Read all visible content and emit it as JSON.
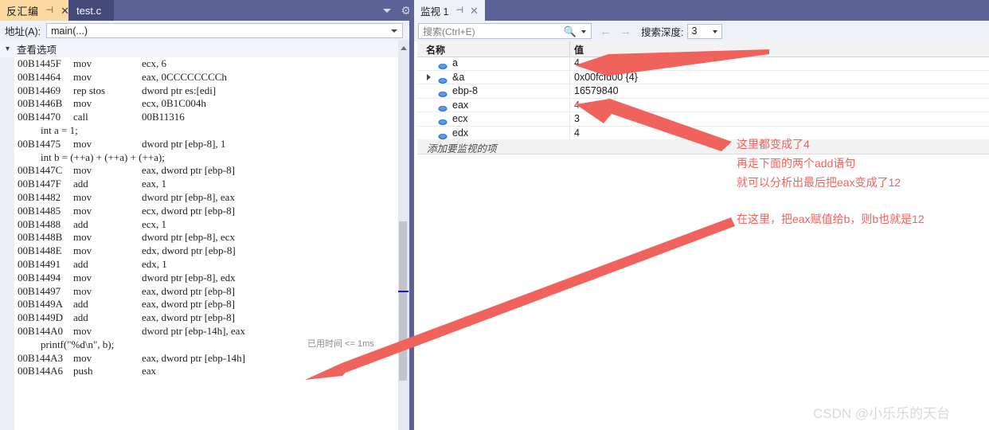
{
  "disassembly": {
    "tabs": [
      {
        "label": "反汇编",
        "active": true,
        "pin": "⊣",
        "close": "✕"
      },
      {
        "label": "test.c",
        "active": false
      }
    ],
    "address_bar": {
      "label": "地址(A):",
      "value": "main(...)"
    },
    "view_options": {
      "label": "查看选项",
      "chevron": "chevron-down-icon"
    },
    "elapsed_label": "已用时间 <= 1ms",
    "current_line_index": 27,
    "lines": [
      {
        "type": "asm",
        "addr": "00B1445F",
        "mn": "mov",
        "op": "ecx, 6"
      },
      {
        "type": "asm",
        "addr": "00B14464",
        "mn": "mov",
        "op": "eax, 0CCCCCCCCh"
      },
      {
        "type": "asm",
        "addr": "00B14469",
        "mn": "rep stos",
        "op": "dword ptr es:[edi]"
      },
      {
        "type": "asm",
        "addr": "00B1446B",
        "mn": "mov",
        "op": "ecx, 0B1C004h"
      },
      {
        "type": "asm",
        "addr": "00B14470",
        "mn": "call",
        "op": "00B11316"
      },
      {
        "type": "src",
        "text": "int a = 1;"
      },
      {
        "type": "asm",
        "addr": "00B14475",
        "mn": "mov",
        "op": "dword ptr [ebp-8], 1"
      },
      {
        "type": "src",
        "text": "int b = (++a) + (++a) + (++a);"
      },
      {
        "type": "asm",
        "addr": "00B1447C",
        "mn": "mov",
        "op": "eax, dword ptr [ebp-8]"
      },
      {
        "type": "asm",
        "addr": "00B1447F",
        "mn": "add",
        "op": "eax, 1"
      },
      {
        "type": "asm",
        "addr": "00B14482",
        "mn": "mov",
        "op": "dword ptr [ebp-8], eax"
      },
      {
        "type": "asm",
        "addr": "00B14485",
        "mn": "mov",
        "op": "ecx, dword ptr [ebp-8]"
      },
      {
        "type": "asm",
        "addr": "00B14488",
        "mn": "add",
        "op": "ecx, 1"
      },
      {
        "type": "asm",
        "addr": "00B1448B",
        "mn": "mov",
        "op": "dword ptr [ebp-8], ecx"
      },
      {
        "type": "asm",
        "addr": "00B1448E",
        "mn": "mov",
        "op": "edx, dword ptr [ebp-8]"
      },
      {
        "type": "asm",
        "addr": "00B14491",
        "mn": "add",
        "op": "edx, 1"
      },
      {
        "type": "asm",
        "addr": "00B14494",
        "mn": "mov",
        "op": "dword ptr [ebp-8], edx"
      },
      {
        "type": "asm",
        "addr": "00B14497",
        "mn": "mov",
        "op": "eax, dword ptr [ebp-8]"
      },
      {
        "type": "asm",
        "addr": "00B1449A",
        "mn": "add",
        "op": "eax, dword ptr [ebp-8]",
        "current": true
      },
      {
        "type": "asm",
        "addr": "00B1449D",
        "mn": "add",
        "op": "eax, dword ptr [ebp-8]"
      },
      {
        "type": "asm",
        "addr": "00B144A0",
        "mn": "mov",
        "op": "dword ptr [ebp-14h], eax"
      },
      {
        "type": "src",
        "text": "printf(\"%d\\n\", b);"
      },
      {
        "type": "asm",
        "addr": "00B144A3",
        "mn": "mov",
        "op": "eax, dword ptr [ebp-14h]"
      },
      {
        "type": "asm",
        "addr": "00B144A6",
        "mn": "push",
        "op": "eax"
      }
    ]
  },
  "watch": {
    "tab": {
      "label": "监视 1",
      "pin": "⊣",
      "close": "✕"
    },
    "toolbar": {
      "search_placeholder": "搜索(Ctrl+E)",
      "search_value": "",
      "search_icon": "magnifier-icon",
      "back_icon": "←",
      "forward_icon": "→",
      "depth_label": "搜索深度:",
      "depth_value": "3"
    },
    "columns": [
      "名称",
      "值"
    ],
    "rows": [
      {
        "name": "a",
        "value": "4",
        "expandable": false,
        "changed": false
      },
      {
        "name": "&a",
        "value": "0x00fcfd00 {4}",
        "expandable": true,
        "changed": false
      },
      {
        "name": "ebp-8",
        "value": "16579840",
        "expandable": false,
        "changed": false
      },
      {
        "name": "eax",
        "value": "4",
        "expandable": false,
        "changed": true
      },
      {
        "name": "ecx",
        "value": "3",
        "expandable": false,
        "changed": false
      },
      {
        "name": "edx",
        "value": "4",
        "expandable": false,
        "changed": false
      }
    ],
    "add_row_placeholder": "添加要监视的项"
  },
  "annotations": {
    "line1": "这里都变成了4",
    "line2": "再走下面的两个add语句",
    "line3": "就可以分析出最后把eax变成了12",
    "line4": "在这里，把eax赋值给b，则b也就是12",
    "color": "#f0625c"
  },
  "watermark": "CSDN @小乐乐的天台"
}
